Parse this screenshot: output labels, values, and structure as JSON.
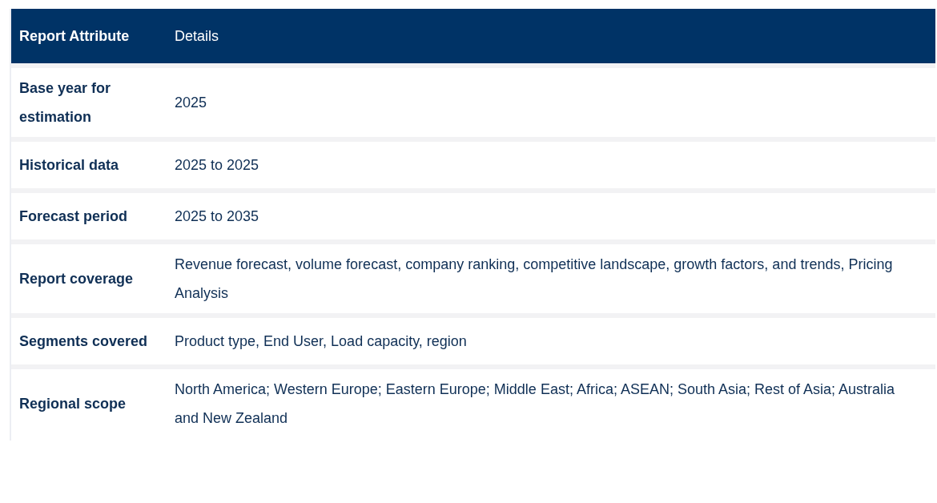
{
  "table": {
    "columns": [
      "Report Attribute",
      "Details"
    ],
    "rows": [
      {
        "attribute": "Base year for estimation",
        "details": "2025"
      },
      {
        "attribute": "Historical data",
        "details": "2025 to 2025"
      },
      {
        "attribute": "Forecast period",
        "details": "2025 to 2035"
      },
      {
        "attribute": "Report coverage",
        "details": "Revenue forecast, volume forecast, company ranking, competitive landscape, growth factors, and trends, Pricing Analysis"
      },
      {
        "attribute": "Segments covered",
        "details": "Product type, End User, Load capacity, region"
      },
      {
        "attribute": "Regional scope",
        "details": "North America; Western Europe; Eastern Europe; Middle East; Africa; ASEAN; South Asia; Rest of Asia; Australia and New Zealand"
      }
    ]
  }
}
